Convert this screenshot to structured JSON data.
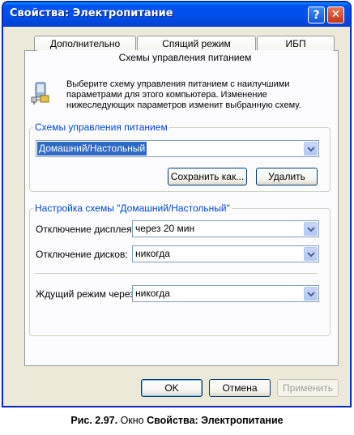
{
  "window": {
    "title": "Свойства: Электропитание",
    "help_glyph": "?",
    "close_glyph": "✕"
  },
  "tabs": [
    {
      "label": "Дополнительно"
    },
    {
      "label": "Спящий режим"
    },
    {
      "label": "ИБП"
    },
    {
      "label": "Схемы управления питанием",
      "active": true
    }
  ],
  "description": "Выберите схему управления питанием с наилучшими параметрами для этого компьютера. Изменение нижеследующих параметров изменит выбранную схему.",
  "icons": {
    "description_icon": "power-scheme-icon",
    "dropdown": "chevron-down-icon",
    "titlebar_help": "help-icon",
    "titlebar_close": "close-icon"
  },
  "schemes_group": {
    "label": "Схемы управления питанием",
    "selected": "Домашний/Настольный",
    "save_as_label": "Сохранить как...",
    "delete_label": "Удалить"
  },
  "settings_group": {
    "label": "Настройка схемы \"Домашний/Настольный\"",
    "display_off": {
      "label": "Отключение дисплея:",
      "value": "через 20 мин"
    },
    "disks_off": {
      "label": "Отключение дисков:",
      "value": "никогда"
    },
    "standby": {
      "label": "Ждущий режим через:",
      "value": "никогда"
    }
  },
  "footer": {
    "ok_label": "OK",
    "cancel_label": "Отмена",
    "apply_label": "Применить",
    "apply_enabled": false
  },
  "caption": {
    "prefix": "Рис. 2.97.",
    "middle": " Окно ",
    "bold_title": "Свойства: Электропитание"
  },
  "colors": {
    "titlebar": "#0050ee",
    "dialog_bg": "#ece9d8",
    "panel_bg": "#fcfcfe",
    "group_label": "#0046d5",
    "selection": "#316ac5"
  }
}
